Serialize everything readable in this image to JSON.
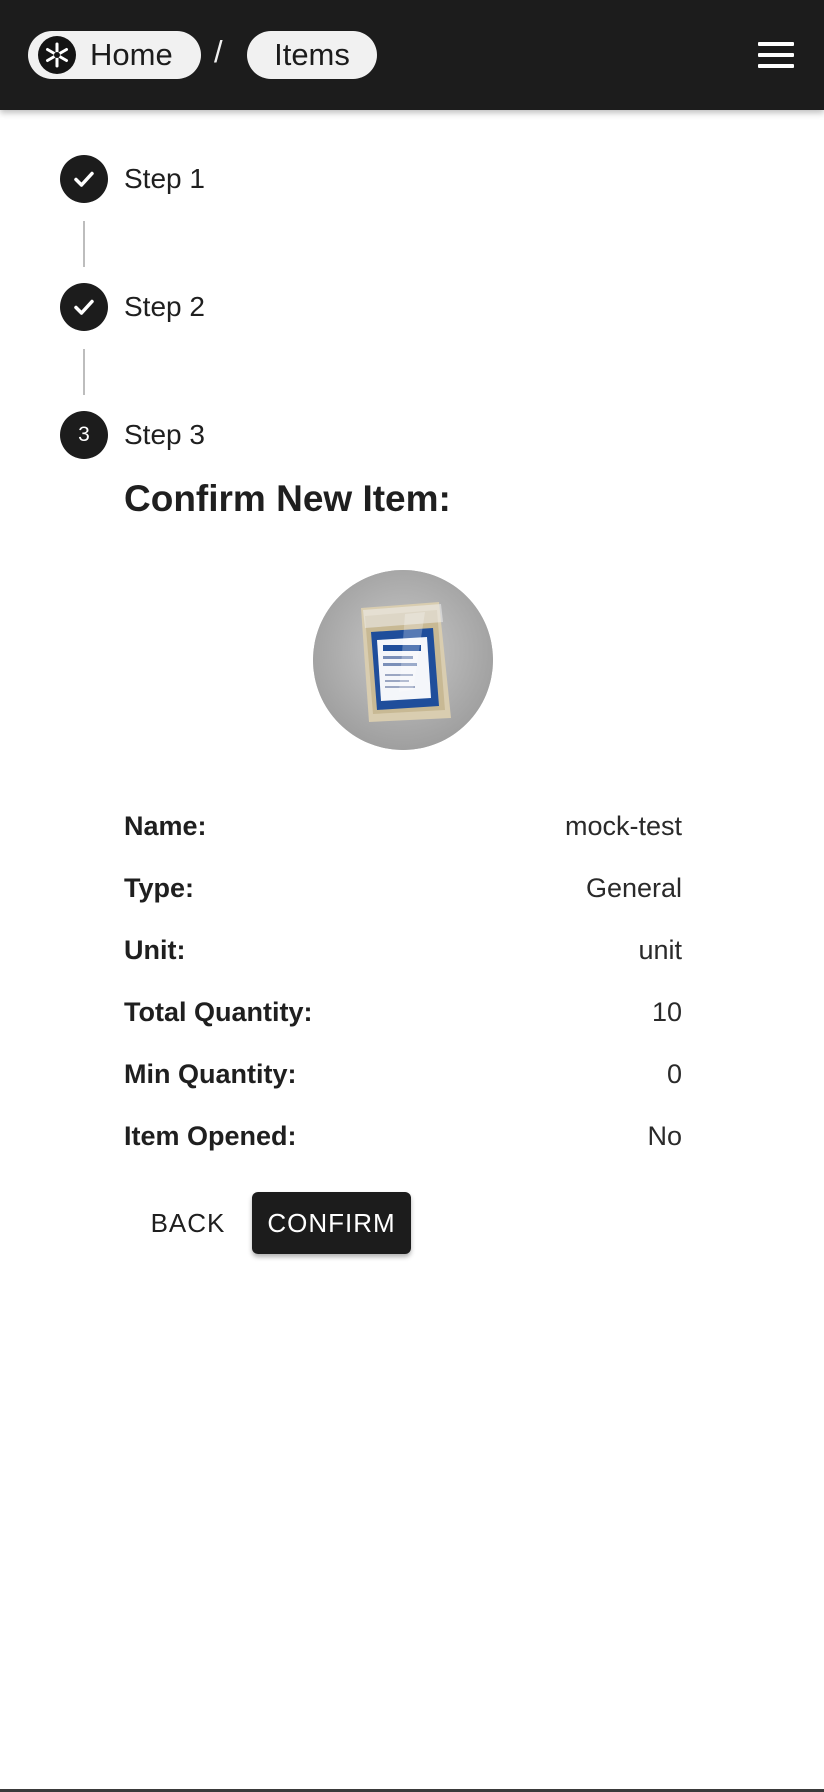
{
  "breadcrumb": {
    "home_label": "Home",
    "separator": "/",
    "items_label": "Items"
  },
  "icons": {
    "logo": "star-of-life-icon",
    "menu": "hamburger-menu-icon",
    "check": "check-icon"
  },
  "stepper": {
    "steps": [
      {
        "label": "Step 1",
        "state": "completed"
      },
      {
        "label": "Step 2",
        "state": "completed"
      },
      {
        "label": "Step 3",
        "state": "active",
        "number": "3"
      }
    ]
  },
  "confirm": {
    "heading": "Confirm New Item:",
    "fields": [
      {
        "label": "Name:",
        "value": "mock-test"
      },
      {
        "label": "Type:",
        "value": "General"
      },
      {
        "label": "Unit:",
        "value": "unit"
      },
      {
        "label": "Total Quantity:",
        "value": "10"
      },
      {
        "label": "Min Quantity:",
        "value": "0"
      },
      {
        "label": "Item Opened:",
        "value": "No"
      }
    ],
    "back_label": "BACK",
    "confirm_label": "CONFIRM"
  },
  "colors": {
    "topbar": "#1c1c1c",
    "pill": "#f1f1f1",
    "primary": "#1c1c1c"
  }
}
